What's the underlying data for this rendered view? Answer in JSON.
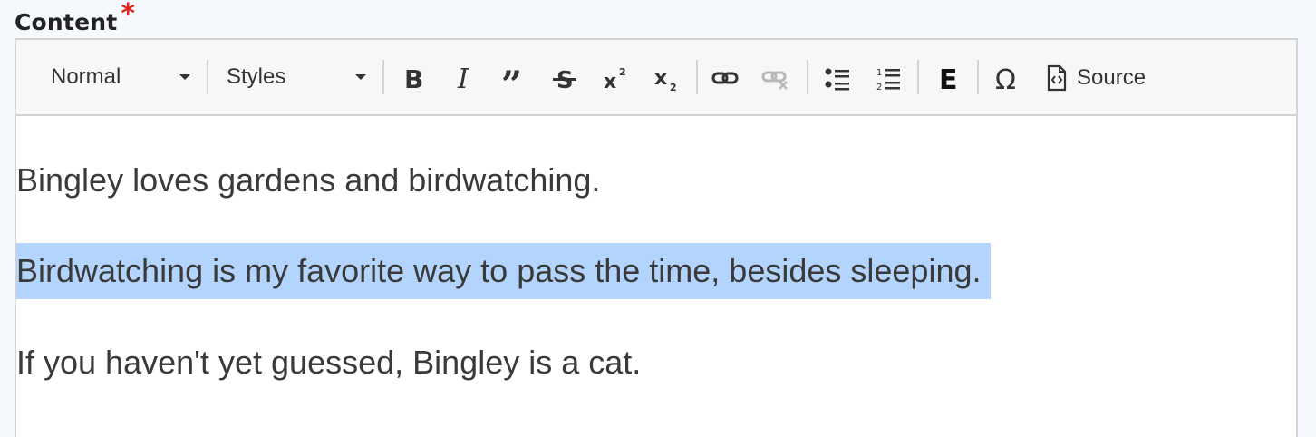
{
  "field": {
    "label": "Content",
    "required_marker": "*"
  },
  "toolbar": {
    "format_dropdown": "Normal",
    "styles_dropdown": "Styles",
    "buttons": {
      "bold": "bold-icon",
      "italic": "italic-icon",
      "blockquote": "blockquote-icon",
      "strikethrough": "strikethrough-icon",
      "superscript": "superscript-icon",
      "subscript": "subscript-icon",
      "link": "link-icon",
      "unlink": "unlink-icon",
      "bulleted_list": "bulleted-list-icon",
      "numbered_list": "numbered-list-icon",
      "embed": "embed-icon",
      "special_char": "omega-icon",
      "source": "source-icon"
    },
    "source_label": "Source",
    "disabled_color": "#b8b8b8",
    "icon_color": "#333333"
  },
  "content": {
    "paragraphs": [
      "Bingley loves gardens and birdwatching.",
      "Birdwatching is my favorite way to pass the time, besides sleeping.",
      "If you haven't yet guessed, Bingley is a cat."
    ],
    "selected_paragraph_index": 1,
    "selection_color": "#b3d4fc"
  }
}
